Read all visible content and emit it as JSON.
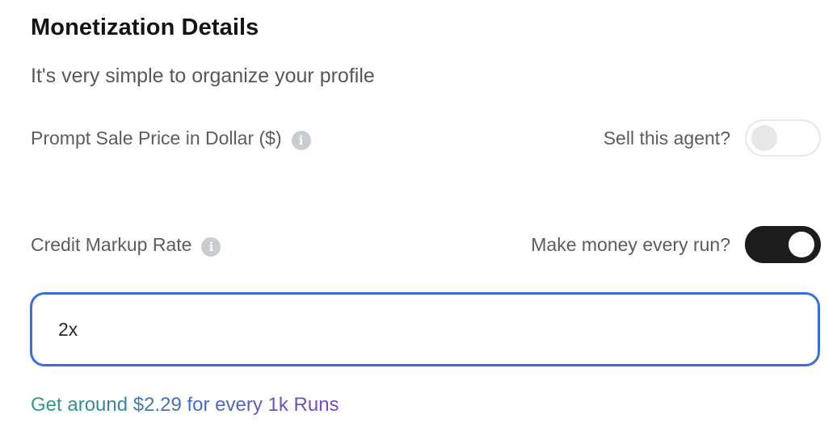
{
  "section": {
    "title": "Monetization Details",
    "subtitle": "It's very simple to organize your profile"
  },
  "price_field": {
    "label": "Prompt Sale Price in Dollar ($)",
    "info_icon": "info-icon",
    "toggle_label": "Sell this agent?",
    "toggle_state": "off"
  },
  "markup_field": {
    "label": "Credit Markup Rate",
    "info_icon": "info-icon",
    "toggle_label": "Make money every run?",
    "toggle_state": "on",
    "value": "2x"
  },
  "earnings_note": "Get around $2.29 for every 1k Runs",
  "colors": {
    "input_focus_border": "#3b6fe0",
    "toggle_on": "#1c1c1c",
    "note_gradient_start": "#2f9e7b",
    "note_gradient_mid": "#3f6fc6",
    "note_gradient_end": "#7b46c4"
  }
}
